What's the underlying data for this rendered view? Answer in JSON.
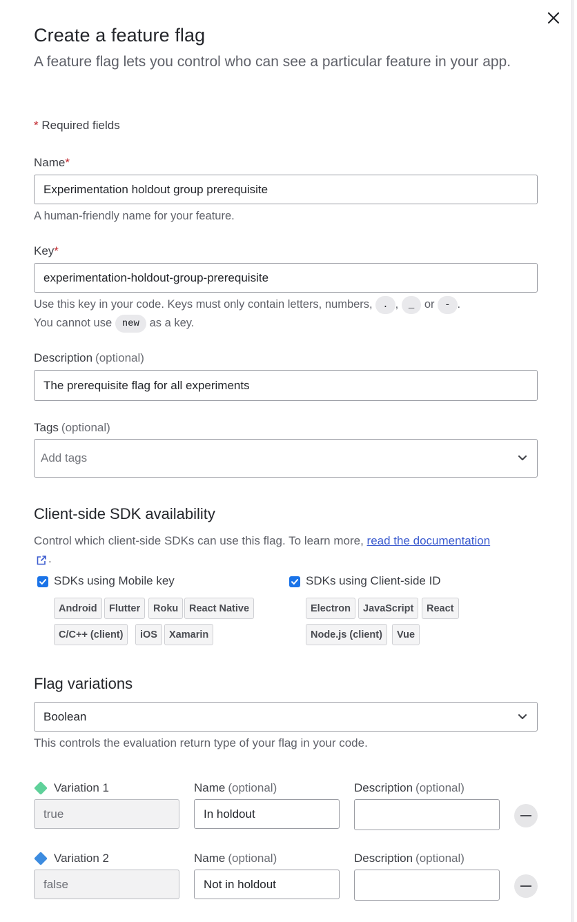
{
  "dialog": {
    "title": "Create a feature flag",
    "subtitle": "A feature flag lets you control who can see a particular feature in your app.",
    "required_star": "*",
    "required_text": " Required fields"
  },
  "name_field": {
    "label": "Name",
    "star": "*",
    "value": "Experimentation holdout group prerequisite",
    "hint": "A human-friendly name for your feature."
  },
  "key_field": {
    "label": "Key",
    "star": "*",
    "value": "experimentation-holdout-group-prerequisite",
    "hint_part1": "Use this key in your code. Keys must only contain letters, numbers,",
    "chars": [
      ".",
      "_",
      "-"
    ],
    "comma": ",",
    "or_text": "or",
    "period": ".",
    "hint_part2": "You cannot use",
    "reserved": "new",
    "hint_part3": "as a key."
  },
  "description_field": {
    "label": "Description",
    "optional": "(optional)",
    "value": "The prerequisite flag for all experiments"
  },
  "tags_field": {
    "label": "Tags",
    "optional": "(optional)",
    "placeholder": "Add tags"
  },
  "sdk": {
    "heading": "Client-side SDK availability",
    "hint": "Control which client-side SDKs can use this flag. To learn more,",
    "link": "read the documentation",
    "mobile": {
      "label": "SDKs using Mobile key",
      "checked": true,
      "tags": [
        "Android",
        "Flutter",
        "Roku",
        "React Native",
        "C/C++ (client)",
        "iOS",
        "Xamarin"
      ]
    },
    "client": {
      "label": "SDKs using Client-side ID",
      "checked": true,
      "tags": [
        "Electron",
        "JavaScript",
        "React",
        "Node.js (client)",
        "Vue"
      ]
    }
  },
  "variations": {
    "heading": "Flag variations",
    "type": "Boolean",
    "hint": "This controls the evaluation return type of your flag in your code.",
    "name_label": "Name",
    "description_label": "Description",
    "optional": "(optional)",
    "items": [
      {
        "label": "Variation 1",
        "value": "true",
        "name": "In holdout",
        "description": "",
        "color": "#5fd19a"
      },
      {
        "label": "Variation 2",
        "value": "false",
        "name": "Not in holdout",
        "description": "",
        "color": "#3d8ce0"
      }
    ]
  },
  "icons": {
    "close": "close-icon",
    "chevron": "chevron-down-icon",
    "external": "external-link-icon",
    "remove": "minus-icon"
  }
}
